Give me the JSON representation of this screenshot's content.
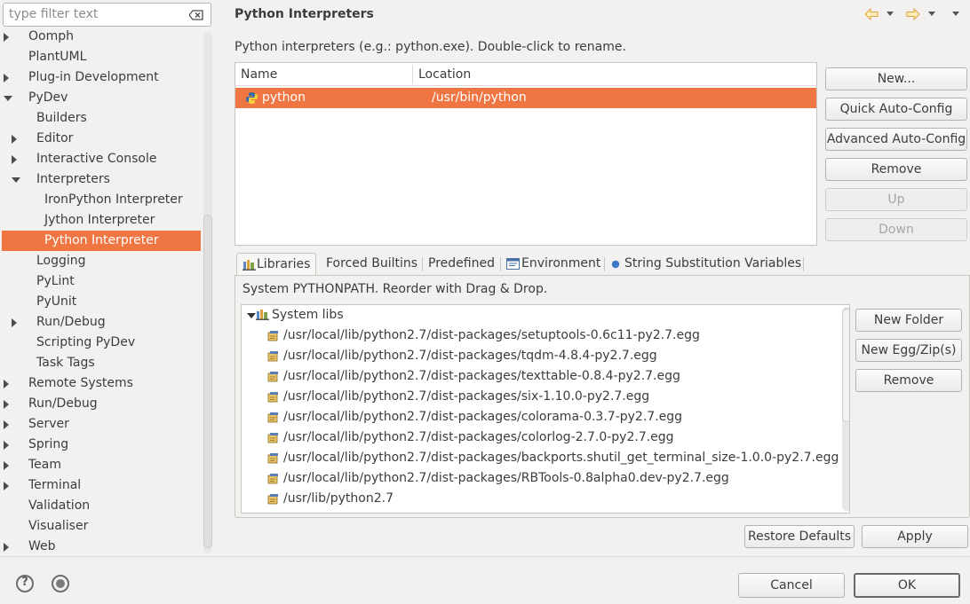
{
  "filter": {
    "placeholder": "type filter text"
  },
  "tree": [
    {
      "label": "Oomph",
      "level": 0,
      "arrow": "right"
    },
    {
      "label": "PlantUML",
      "level": 0,
      "arrow": "none"
    },
    {
      "label": "Plug-in Development",
      "level": 0,
      "arrow": "right"
    },
    {
      "label": "PyDev",
      "level": 0,
      "arrow": "down"
    },
    {
      "label": "Builders",
      "level": 1,
      "arrow": "none"
    },
    {
      "label": "Editor",
      "level": 1,
      "arrow": "right"
    },
    {
      "label": "Interactive Console",
      "level": 1,
      "arrow": "right"
    },
    {
      "label": "Interpreters",
      "level": 1,
      "arrow": "down"
    },
    {
      "label": "IronPython Interpreter",
      "level": 2,
      "arrow": "none"
    },
    {
      "label": "Jython Interpreter",
      "level": 2,
      "arrow": "none"
    },
    {
      "label": "Python Interpreter",
      "level": 2,
      "arrow": "none",
      "selected": true
    },
    {
      "label": "Logging",
      "level": 1,
      "arrow": "none"
    },
    {
      "label": "PyLint",
      "level": 1,
      "arrow": "none"
    },
    {
      "label": "PyUnit",
      "level": 1,
      "arrow": "none"
    },
    {
      "label": "Run/Debug",
      "level": 1,
      "arrow": "right"
    },
    {
      "label": "Scripting PyDev",
      "level": 1,
      "arrow": "none"
    },
    {
      "label": "Task Tags",
      "level": 1,
      "arrow": "none"
    },
    {
      "label": "Remote Systems",
      "level": 0,
      "arrow": "right"
    },
    {
      "label": "Run/Debug",
      "level": 0,
      "arrow": "right"
    },
    {
      "label": "Server",
      "level": 0,
      "arrow": "right"
    },
    {
      "label": "Spring",
      "level": 0,
      "arrow": "right"
    },
    {
      "label": "Team",
      "level": 0,
      "arrow": "right"
    },
    {
      "label": "Terminal",
      "level": 0,
      "arrow": "right"
    },
    {
      "label": "Validation",
      "level": 0,
      "arrow": "none"
    },
    {
      "label": "Visualiser",
      "level": 0,
      "arrow": "none"
    },
    {
      "label": "Web",
      "level": 0,
      "arrow": "right"
    }
  ],
  "page": {
    "title": "Python Interpreters",
    "description": "Python interpreters (e.g.: python.exe).   Double-click to rename."
  },
  "interp_table": {
    "col_name": "Name",
    "col_location": "Location",
    "row": {
      "name": "python",
      "location": "/usr/bin/python"
    }
  },
  "interp_buttons": {
    "new": "New...",
    "quick": "Quick Auto-Config",
    "advanced": "Advanced Auto-Config",
    "remove": "Remove",
    "up": "Up",
    "down": "Down"
  },
  "tabs": {
    "libraries": "Libraries",
    "forced": "Forced Builtins",
    "predefined": "Predefined",
    "environment": "Environment",
    "substitution": "String Substitution Variables"
  },
  "libraries": {
    "description": "System PYTHONPATH.   Reorder with Drag & Drop.",
    "root": "System libs",
    "paths": [
      "/usr/local/lib/python2.7/dist-packages/setuptools-0.6c11-py2.7.egg",
      "/usr/local/lib/python2.7/dist-packages/tqdm-4.8.4-py2.7.egg",
      "/usr/local/lib/python2.7/dist-packages/texttable-0.8.4-py2.7.egg",
      "/usr/local/lib/python2.7/dist-packages/six-1.10.0-py2.7.egg",
      "/usr/local/lib/python2.7/dist-packages/colorama-0.3.7-py2.7.egg",
      "/usr/local/lib/python2.7/dist-packages/colorlog-2.7.0-py2.7.egg",
      "/usr/local/lib/python2.7/dist-packages/backports.shutil_get_terminal_size-1.0.0-py2.7.egg",
      "/usr/local/lib/python2.7/dist-packages/RBTools-0.8alpha0.dev-py2.7.egg",
      "/usr/lib/python2.7"
    ],
    "new_folder": "New Folder",
    "new_egg": "New Egg/Zip(s)",
    "remove": "Remove"
  },
  "footer": {
    "restore": "Restore Defaults",
    "apply": "Apply",
    "cancel": "Cancel",
    "ok": "OK"
  },
  "colors": {
    "selection": "#ef7543",
    "background": "#f2f1f0"
  }
}
